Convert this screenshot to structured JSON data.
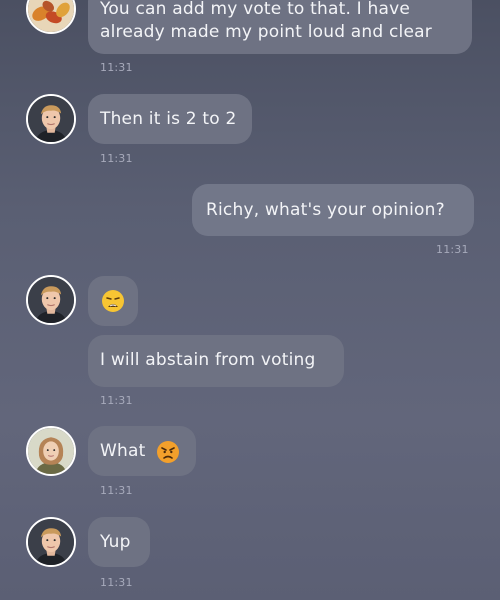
{
  "messages": [
    {
      "sender": "other-1",
      "text_line1": "You can add my vote to that. I have",
      "text_line2": "already made my point loud and clear",
      "time": "11:31"
    },
    {
      "sender": "richy",
      "text": "Then it is 2 to 2",
      "time": "11:31"
    },
    {
      "sender": "me",
      "text": "Richy, what's your opinion?",
      "time": "11:31"
    },
    {
      "sender": "richy",
      "emoji": "weary-face-icon"
    },
    {
      "sender": "richy",
      "text": "I will abstain from voting",
      "time": "11:31"
    },
    {
      "sender": "woman",
      "text": "What",
      "emoji": "angry-face-icon",
      "time": "11:31"
    },
    {
      "sender": "richy",
      "text": "Yup",
      "time": "11:31"
    }
  ],
  "colors": {
    "background_top": "#4b5062",
    "background_bottom": "#5b5f74",
    "bubble": "#6e7283",
    "time_text": "#a7aabb"
  }
}
